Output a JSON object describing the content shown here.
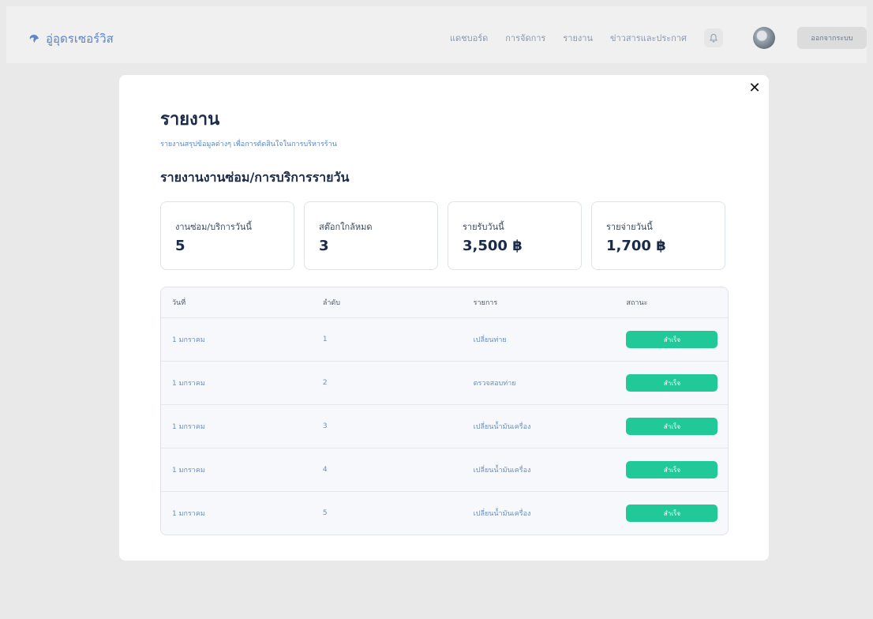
{
  "header": {
    "brand_name": "อู่อุดรเซอร์วิส",
    "nav": [
      "แดชบอร์ด",
      "การจัดการ",
      "รายงาน",
      "ข่าวสารและประกาศ"
    ],
    "logout_label": "ออกจากระบบ"
  },
  "modal": {
    "close_label": "✕",
    "title": "รายงาน",
    "subtitle": "รายงานสรุปข้อมูลต่างๆ เพื่อการตัดสินใจในการบริหารร้าน",
    "section_title": "รายงานงานซ่อม/การบริการรายวัน",
    "cards": [
      {
        "label": "งานซ่อม/บริการวันนี้",
        "value": "5"
      },
      {
        "label": "สต๊อกใกล้หมด",
        "value": "3"
      },
      {
        "label": "รายรับวันนี้",
        "value": "3,500 ฿"
      },
      {
        "label": "รายจ่ายวันนี้",
        "value": "1,700 ฿"
      }
    ],
    "table": {
      "headers": [
        "วันที่",
        "ลำดับ",
        "รายการ",
        "สถานะ"
      ],
      "rows": [
        {
          "date": "1 มกราคม",
          "no": "1",
          "item": "เปลี่ยนท่าย",
          "status": "สำเร็จ"
        },
        {
          "date": "1 มกราคม",
          "no": "2",
          "item": "ตรวจสอบท่าย",
          "status": "สำเร็จ"
        },
        {
          "date": "1 มกราคม",
          "no": "3",
          "item": "เปลี่ยนน้ำมันเครื่อง",
          "status": "สำเร็จ"
        },
        {
          "date": "1 มกราคม",
          "no": "4",
          "item": "เปลี่ยนน้ำมันเครื่อง",
          "status": "สำเร็จ"
        },
        {
          "date": "1 มกราคม",
          "no": "5",
          "item": "เปลี่ยนน้ำมันเครื่อง",
          "status": "สำเร็จ"
        }
      ]
    }
  },
  "colors": {
    "accent": "#5b86c7",
    "success": "#20c997",
    "backdrop": "#e9e9e9"
  },
  "icons": {
    "brand": "wave-icon",
    "notification": "bell-icon",
    "close": "close-icon"
  }
}
